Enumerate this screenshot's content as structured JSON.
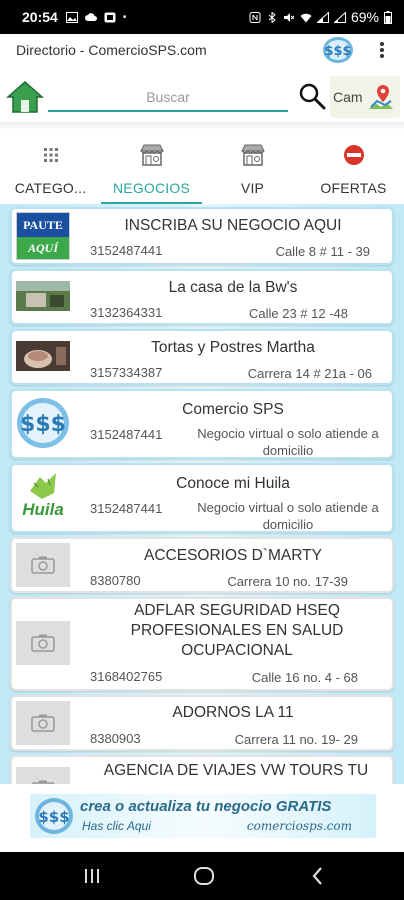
{
  "status_bar": {
    "time": "20:54",
    "battery": "69%"
  },
  "app_bar": {
    "title": "Directorio - ComercioSPS.com"
  },
  "search": {
    "placeholder": "Buscar",
    "cam_label": "Cam"
  },
  "tabs": [
    {
      "label": "CATEGO...",
      "icon": "grid-dots-icon",
      "active": false
    },
    {
      "label": "NEGOCIOS",
      "icon": "shop-icon",
      "active": true
    },
    {
      "label": "VIP",
      "icon": "vip-shop-icon",
      "active": false
    },
    {
      "label": "OFERTAS",
      "icon": "offers-tag-icon",
      "active": false
    }
  ],
  "businesses": [
    {
      "name": "INSCRIBA SU NEGOCIO AQUI",
      "phone": "3152487441",
      "address": "Calle 8  # 11 - 39",
      "thumb": "paute-aqui-logo",
      "thumb_text": "PAUTE AQUÍ"
    },
    {
      "name": "La casa de la Bw's",
      "phone": "3132364331",
      "address": "Calle 23 # 12 -48",
      "thumb": "storefront-photo"
    },
    {
      "name": "Tortas y Postres Martha",
      "phone": "3157334387",
      "address": "Carrera 14 # 21a - 06",
      "thumb": "cake-photo"
    },
    {
      "name": "Comercio SPS",
      "phone": "3152487441",
      "address": "Negocio virtual o solo atiende a domicilio",
      "thumb": "sps-logo"
    },
    {
      "name": "Conoce mi Huila",
      "phone": "3152487441",
      "address": "Negocio virtual o solo atiende a domicilio",
      "thumb": "huila-logo",
      "thumb_text": "Huila"
    },
    {
      "name": "ACCESORIOS D`MARTY",
      "phone": "8380780",
      "address": "Carrera 10 no. 17-39",
      "thumb": "no-image-placeholder"
    },
    {
      "name": "ADFLAR SEGURIDAD HSEQ PROFESIONALES EN SALUD OCUPACIONAL",
      "phone": "3168402765",
      "address": "Calle 16 no. 4 - 68",
      "thumb": "no-image-placeholder"
    },
    {
      "name": "ADORNOS LA 11",
      "phone": "8380903",
      "address": "Carrera 11  no.  19- 29",
      "thumb": "no-image-placeholder"
    },
    {
      "name": "AGENCIA DE VIAJES VW TOURS TU DESTINO",
      "phone": "",
      "address": "",
      "thumb": "no-image-placeholder"
    }
  ],
  "banner": {
    "main": "crea o actualiza tu negocio GRATIS",
    "sub": "Has clic Aqui",
    "url": "comerciosps.com"
  },
  "colors": {
    "accent": "#2aa7a0",
    "list_bg": "#bfe9f7",
    "banner_text": "#2a6a8a"
  }
}
